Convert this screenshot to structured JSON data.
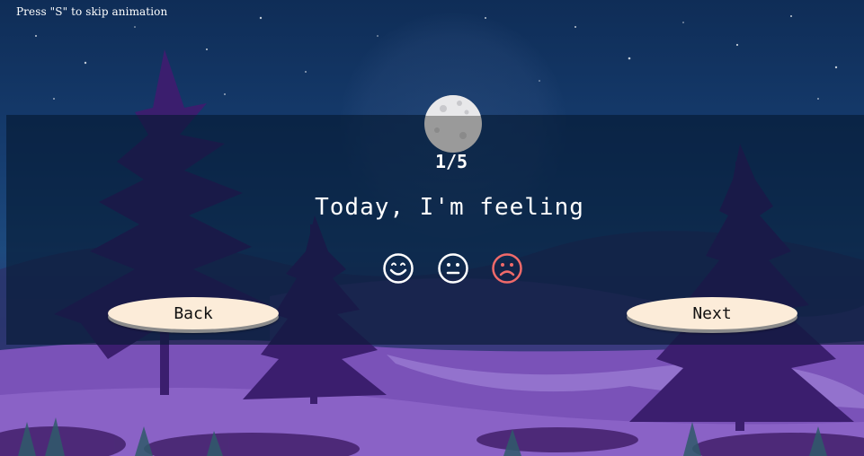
{
  "skip_hint": "Press \"S\" to skip animation",
  "progress": {
    "current": 1,
    "total": 5,
    "label": "1/5"
  },
  "question": "Today, I'm feeling",
  "moods": [
    {
      "icon": "happy-face-icon",
      "color": "#ffffff"
    },
    {
      "icon": "neutral-face-icon",
      "color": "#ffffff"
    },
    {
      "icon": "sad-face-icon",
      "color": "#f06a6a"
    }
  ],
  "buttons": {
    "back_label": "Back",
    "next_label": "Next"
  },
  "colors": {
    "button_bg": "#fcecd9",
    "sad_accent": "#f06a6a",
    "panel": "#051930"
  }
}
